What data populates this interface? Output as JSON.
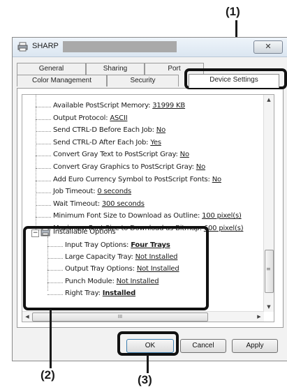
{
  "callouts": {
    "c1": "(1)",
    "c2": "(2)",
    "c3": "(3)"
  },
  "window": {
    "title": "SHARP",
    "close_glyph": "✕"
  },
  "tabs": {
    "general": "General",
    "sharing": "Sharing",
    "ports": "Port",
    "color": "Color Management",
    "security": "Security",
    "device": "Device Settings"
  },
  "tree": [
    {
      "label": "Available PostScript Memory: ",
      "value": "31999 KB"
    },
    {
      "label": "Output Protocol: ",
      "value": "ASCII"
    },
    {
      "label": "Send CTRL-D Before Each Job: ",
      "value": "No"
    },
    {
      "label": "Send CTRL-D After Each Job: ",
      "value": "Yes"
    },
    {
      "label": "Convert Gray Text to PostScript Gray: ",
      "value": "No"
    },
    {
      "label": "Convert Gray Graphics to PostScript Gray: ",
      "value": "No"
    },
    {
      "label": "Add Euro Currency Symbol to PostScript Fonts: ",
      "value": "No"
    },
    {
      "label": "Job Timeout: ",
      "value": "0 seconds"
    },
    {
      "label": "Wait Timeout: ",
      "value": "300 seconds"
    },
    {
      "label": "Minimum Font Size to Download as Outline: ",
      "value": "100 pixel(s)"
    },
    {
      "label": "Maximum Font Size to Download as Bitmap: ",
      "value": "600 pixel(s)"
    }
  ],
  "installable": {
    "heading": "Installable Options",
    "expander": "−",
    "items": [
      {
        "label": "Input Tray Options: ",
        "value": "Four Trays",
        "bold": true
      },
      {
        "label": "Large Capacity Tray: ",
        "value": "Not Installed",
        "bold": false
      },
      {
        "label": "Output Tray Options: ",
        "value": "Not Installed",
        "bold": false
      },
      {
        "label": "Punch Module: ",
        "value": "Not Installed",
        "bold": false
      },
      {
        "label": "Right Tray: ",
        "value": "Installed",
        "bold": true
      }
    ]
  },
  "scroll": {
    "up": "▲",
    "down": "▼",
    "left": "◀",
    "right": "▶",
    "grip": "≡",
    "hgrip": "III"
  },
  "buttons": {
    "ok": "OK",
    "cancel": "Cancel",
    "apply": "Apply"
  }
}
